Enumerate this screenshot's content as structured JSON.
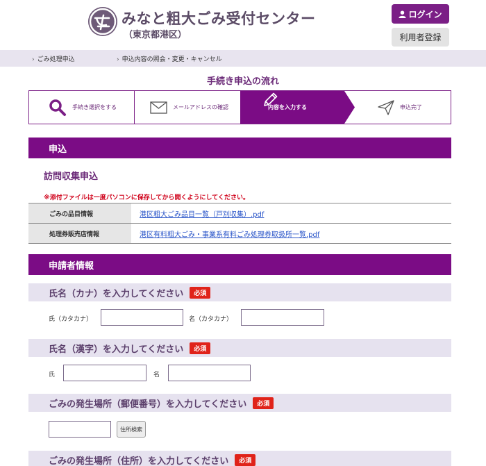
{
  "header": {
    "title": "みなと粗大ごみ受付センター",
    "subtitle": "（東京都港区）",
    "login_label": "ログイン",
    "register_label": "利用者登録"
  },
  "nav": {
    "items": [
      {
        "label": "ごみ処理申込"
      },
      {
        "label": "申込内容の照会・変更・キャンセル"
      }
    ]
  },
  "flow": {
    "title": "手続き申込の流れ",
    "steps": [
      {
        "label": "手続き選択をする",
        "icon": "search-icon",
        "active": false
      },
      {
        "label": "メールアドレスの確認",
        "icon": "envelope-icon",
        "active": false
      },
      {
        "label": "内容を入力する",
        "icon": "pencil-icon",
        "active": true
      },
      {
        "label": "申込完了",
        "icon": "paper-plane-icon",
        "active": false
      }
    ]
  },
  "application": {
    "section_title": "申込",
    "subheading": "訪問収集申込",
    "notice": "※添付ファイルは一度パソコンに保存してから開くようにしてください。",
    "rows": [
      {
        "label": "ごみの品目情報",
        "link": "港区粗大ごみ品目一覧（戸別収集）.pdf"
      },
      {
        "label": "処理券販売店情報",
        "link": "港区有料粗大ごみ・事業系有料ごみ処理券取扱所一覧.pdf"
      }
    ]
  },
  "applicant": {
    "section_title": "申請者情報",
    "required_label": "必須",
    "kana": {
      "heading": "氏名（カナ）を入力してください",
      "surname_label": "氏（カタカナ）",
      "given_label": "名（カタカナ）",
      "surname_value": "",
      "given_value": ""
    },
    "kanji": {
      "heading": "氏名（漢字）を入力してください",
      "surname_label": "氏",
      "given_label": "名",
      "surname_value": "",
      "given_value": ""
    },
    "postal": {
      "heading": "ごみの発生場所（郵便番号）を入力してください",
      "value": "",
      "search_label": "住所検索"
    },
    "address": {
      "heading": "ごみの発生場所（住所）を入力してください"
    }
  },
  "colors": {
    "brand": "#7b0c85",
    "brand_text": "#6b2a78",
    "required": "#e0231a",
    "link": "#2a55c9",
    "subhead_bg": "#e6e2ef"
  }
}
